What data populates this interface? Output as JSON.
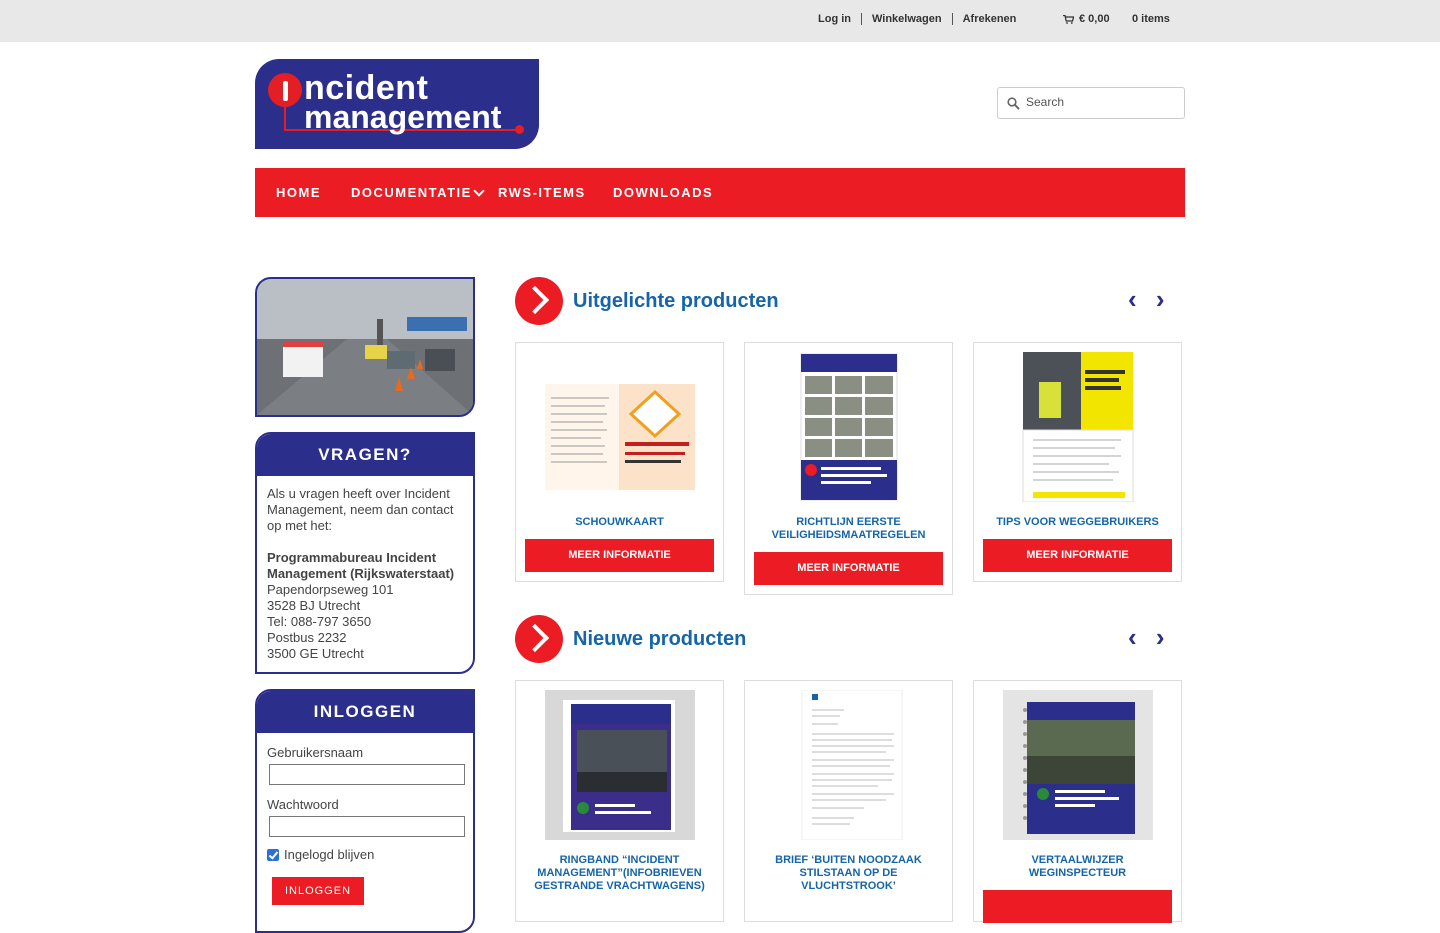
{
  "topbar": {
    "login": "Log in",
    "cart": "Winkelwagen",
    "checkout": "Afrekenen",
    "total": "€ 0,00",
    "items": "0 items"
  },
  "search": {
    "placeholder": "Search"
  },
  "nav": {
    "home": "HOME",
    "documentatie": "DOCUMENTATIE",
    "rws": "RWS-ITEMS",
    "downloads": "DOWNLOADS"
  },
  "logo": {
    "line1": "ncident",
    "line2": "management"
  },
  "vragen": {
    "title": "VRAGEN?",
    "intro": "Als u vragen heeft over Incident Management, neem dan contact op met het:",
    "org": "Programmabureau Incident Management (Rijkswaterstaat)",
    "address1": "Papendorpseweg 101",
    "address2": "3528 BJ Utrecht",
    "phone": "Tel: 088-797 3650",
    "pobox": "Postbus 2232",
    "pocity": "3500 GE Utrecht"
  },
  "inloggen": {
    "title": "INLOGGEN",
    "username_label": "Gebruikersnaam",
    "password_label": "Wachtwoord",
    "remember_label": "Ingelogd blijven",
    "button": "INLOGGEN"
  },
  "featured": {
    "title": "Uitgelichte producten",
    "arrows": "‹ ›",
    "products": [
      {
        "title": "SCHOUWKAART",
        "button": "MEER INFORMATIE"
      },
      {
        "title": "RICHTLIJN EERSTE VEILIGHEIDSMAATREGELEN",
        "button": "MEER INFORMATIE"
      },
      {
        "title": "TIPS VOOR WEGGEBRUIKERS",
        "button": "MEER INFORMATIE"
      }
    ]
  },
  "newproducts": {
    "title": "Nieuwe producten",
    "arrows": "‹ ›",
    "products": [
      {
        "title": "RINGBAND “INCIDENT MANAGEMENT”(INFOBRIEVEN GESTRANDE VRACHTWAGENS)"
      },
      {
        "title": "BRIEF ‘BUITEN NOODZAAK STILSTAAN OP DE VLUCHTSTROOK’"
      },
      {
        "title": "VERTAALWIJZER WEGINSPECTEUR"
      }
    ]
  },
  "colors": {
    "brand_red": "#ec1c24",
    "brand_blue": "#2b2e8a",
    "title_blue": "#1565a8"
  }
}
